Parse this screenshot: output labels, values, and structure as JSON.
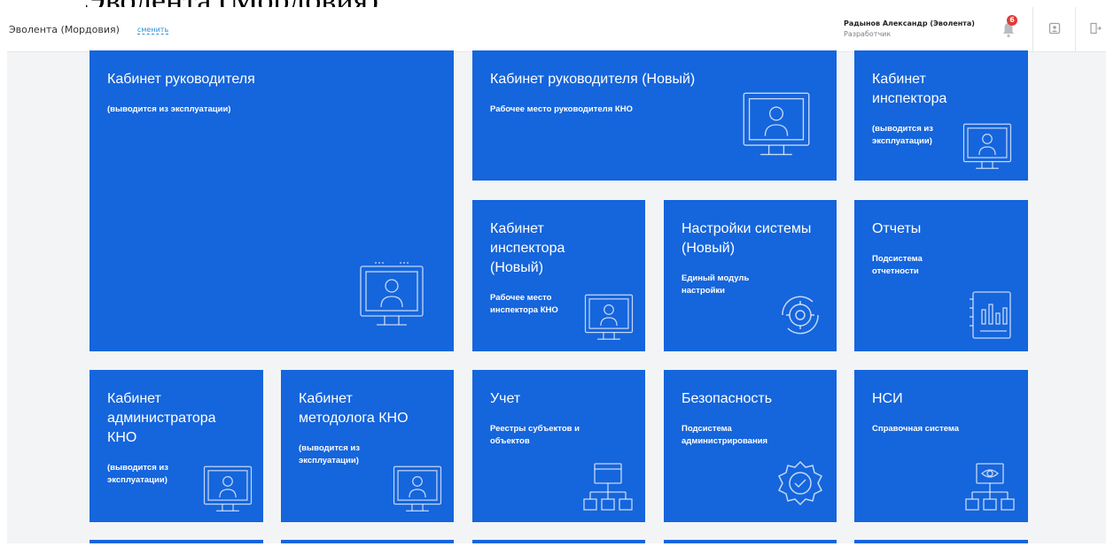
{
  "caption": "Эволента (Мордовия)",
  "header": {
    "org_name": "Эволента (Мордовия)",
    "change_link": "сменить",
    "user_name": "Радынов Александр (Эволента)",
    "user_role": "Разработчик",
    "notifications_count": "6"
  },
  "tiles": {
    "head_cabinet": {
      "title": "Кабинет руководителя",
      "desc": "(выводится из эксплуатации)"
    },
    "head_cabinet_new": {
      "title": "Кабинет руководителя (Новый)",
      "desc": "Рабочее место руководителя КНО"
    },
    "inspector_cabinet": {
      "title": "Кабинет инспектора",
      "desc": "(выводится из эксплуатации)"
    },
    "inspector_cabinet_new": {
      "title": "Кабинет инспектора (Новый)",
      "desc": "Рабочее место инспектора КНО"
    },
    "system_settings_new": {
      "title": "Настройки системы (Новый)",
      "desc": "Единый модуль настройки"
    },
    "reports": {
      "title": "Отчеты",
      "desc": "Подсистема отчетности"
    },
    "admin_cabinet": {
      "title": "Кабинет администратора КНО",
      "desc": "(выводится из эксплуатации)"
    },
    "methodologist_cabinet": {
      "title": "Кабинет методолога КНО",
      "desc": "(выводится из эксплуатации)"
    },
    "accounting": {
      "title": "Учет",
      "desc": "Реестры субъектов и объектов"
    },
    "security": {
      "title": "Безопасность",
      "desc": "Подсистема администрирования"
    },
    "nsi": {
      "title": "НСИ",
      "desc": "Справочная система"
    }
  },
  "colors": {
    "tile_bg": "#1565dc",
    "page_bg": "#f3f4f6",
    "link": "#2b8fd6",
    "badge": "#e53935"
  },
  "icons": [
    "bell-icon",
    "user-card-icon",
    "logout-icon",
    "monitor-person-icon",
    "gear-cycle-icon",
    "report-chart-icon",
    "network-registry-icon",
    "gear-check-icon",
    "network-eye-icon"
  ]
}
